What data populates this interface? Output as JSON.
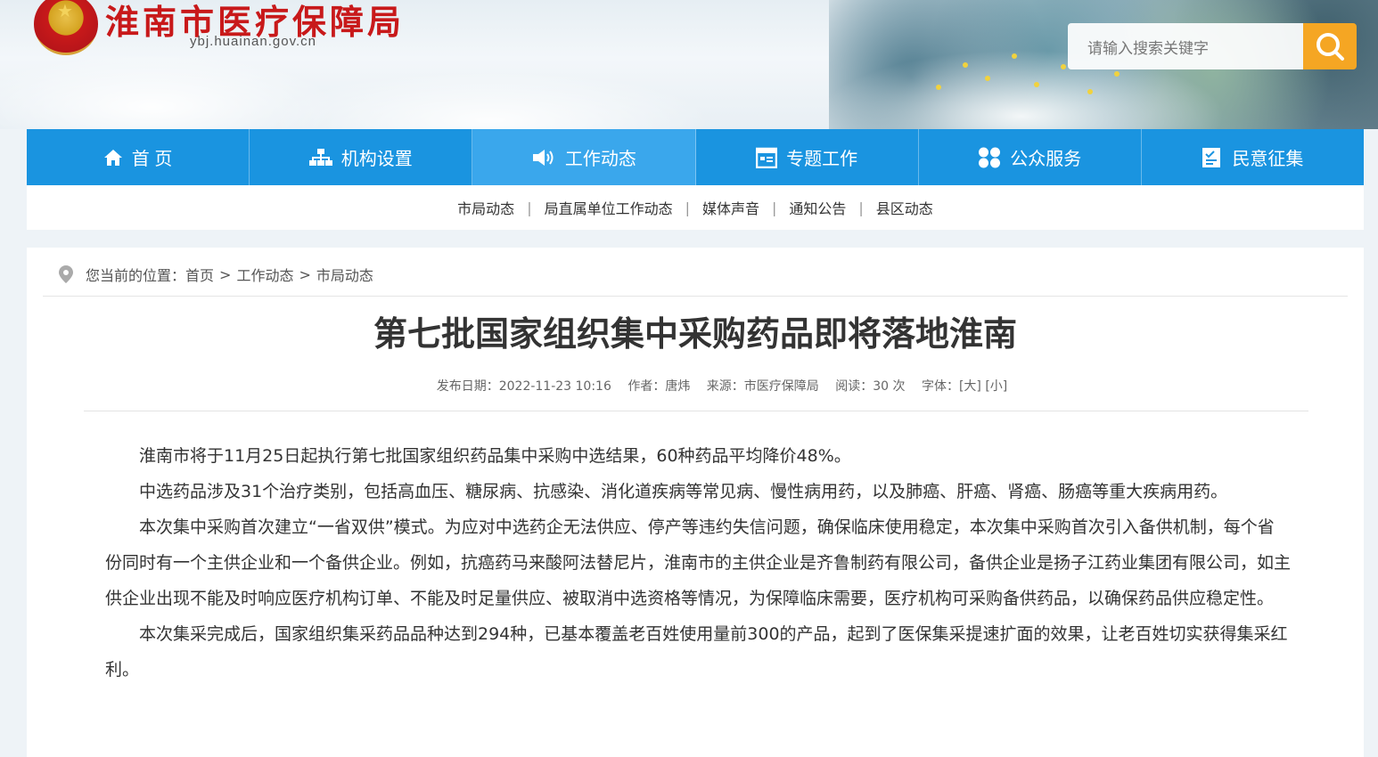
{
  "site": {
    "title": "淮南市医疗保障局",
    "domain": "ybj.huainan.gov.cn"
  },
  "search": {
    "placeholder": "请输入搜索关键字",
    "icon": "search-icon"
  },
  "nav": {
    "items": [
      {
        "label": "首 页",
        "icon": "home-icon"
      },
      {
        "label": "机构设置",
        "icon": "org-chart-icon"
      },
      {
        "label": "工作动态",
        "icon": "speaker-icon",
        "active": true
      },
      {
        "label": "专题工作",
        "icon": "calendar-icon"
      },
      {
        "label": "公众服务",
        "icon": "grid-icon"
      },
      {
        "label": "民意征集",
        "icon": "feedback-icon"
      }
    ]
  },
  "subnav": {
    "items": [
      "市局动态",
      "局直属单位工作动态",
      "媒体声音",
      "通知公告",
      "县区动态"
    ]
  },
  "breadcrumb": {
    "prefix": "您当前的位置：",
    "items": [
      "首页",
      "工作动态",
      "市局动态"
    ]
  },
  "article": {
    "title": "第七批国家组织集中采购药品即将落地淮南",
    "meta": {
      "date": "发布日期：2022-11-23 10:16",
      "author": "作者：唐炜",
      "source": "来源：市医疗保障局",
      "views": "阅读：30 次",
      "font": "字体：[大] [小]"
    },
    "paragraphs": [
      "淮南市将于11月25日起执行第七批国家组织药品集中采购中选结果，60种药品平均降价48%。",
      "中选药品涉及31个治疗类别，包括高血压、糖尿病、抗感染、消化道疾病等常见病、慢性病用药，以及肺癌、肝癌、肾癌、肠癌等重大疾病用药。",
      "本次集中采购首次建立“一省双供”模式。为应对中选药企无法供应、停产等违约失信问题，确保临床使用稳定，本次集中采购首次引入备供机制，每个省份同时有一个主供企业和一个备供企业。例如，抗癌药马来酸阿法替尼片，淮南市的主供企业是齐鲁制药有限公司，备供企业是扬子江药业集团有限公司，如主供企业出现不能及时响应医疗机构订单、不能及时足量供应、被取消中选资格等情况，为保障临床需要，医疗机构可采购备供药品，以确保药品供应稳定性。",
      "本次集采完成后，国家组织集采药品品种达到294种，已基本覆盖老百姓使用量前300的产品，起到了医保集采提速扩面的效果，让老百姓切实获得集采红利。"
    ]
  },
  "colors": {
    "nav": "#1a94e0",
    "nav_active": "#3aa7ec",
    "title_red": "#c8191a",
    "search_button": "#f5a623"
  }
}
